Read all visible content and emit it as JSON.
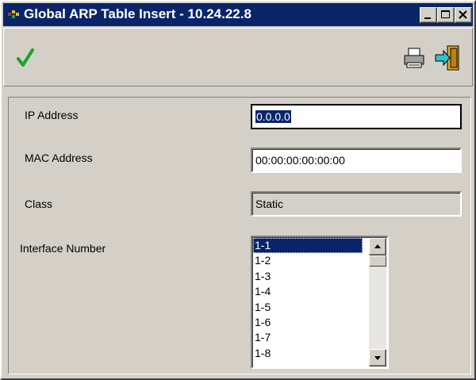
{
  "window": {
    "title": "Global ARP Table Insert - 10.24.22.8",
    "controls": [
      "minimize-icon",
      "maximize-icon",
      "close-icon"
    ]
  },
  "toolbar": {
    "tools": [
      "checkmark-icon",
      "printer-icon",
      "exit-door-icon"
    ]
  },
  "form": {
    "ip_address": {
      "label": "IP Address",
      "value": "0.0.0.0"
    },
    "mac_address": {
      "label": "MAC Address",
      "value": "00:00:00:00:00:00"
    },
    "class": {
      "label": "Class",
      "value": "Static"
    },
    "interface_number": {
      "label": "Interface Number",
      "options": [
        "1-1",
        "1-2",
        "1-3",
        "1-4",
        "1-5",
        "1-6",
        "1-7",
        "1-8"
      ],
      "selected": "1-1"
    }
  },
  "colors": {
    "titlebar": "#0a246a",
    "face": "#d4d0c8",
    "checkmark": "#1aa32a",
    "selection": "#0a246a"
  }
}
